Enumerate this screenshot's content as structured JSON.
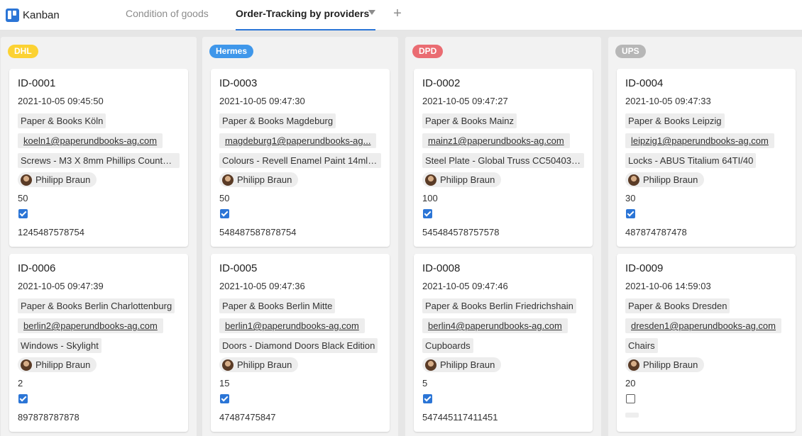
{
  "app": {
    "title": "Kanban",
    "icon": "kanban-board-icon"
  },
  "tabs": {
    "inactive_label": "Condition of goods",
    "active_label": "Order-Tracking by providers",
    "add_label": "+"
  },
  "colors": {
    "accent": "#2b75d6",
    "dhl": "#fcd232",
    "hermes": "#3f97ea",
    "dpd": "#ea6c72",
    "ups": "#b7b7b7"
  },
  "columns": [
    {
      "label": "DHL",
      "cards": [
        {
          "id": "ID-0001",
          "date": "2021-10-05 09:45:50",
          "store": "Paper & Books Köln",
          "email": "koeln1@paperundbooks-ag.com",
          "product": "Screws - M3 X 8mm Phillips Counter…",
          "user": "Philipp Braun",
          "qty": "50",
          "checked": true,
          "tracking": "1245487578754"
        },
        {
          "id": "ID-0006",
          "date": "2021-10-05 09:47:39",
          "store": "Paper & Books Berlin Charlottenburg",
          "email": "berlin2@paperundbooks-ag.com",
          "product": "Windows - Skylight",
          "user": "Philipp Braun",
          "qty": "2",
          "checked": true,
          "tracking": "897878787878"
        }
      ]
    },
    {
      "label": "Hermes",
      "cards": [
        {
          "id": "ID-0003",
          "date": "2021-10-05 09:47:30",
          "store": "Paper & Books Magdeburg",
          "email": "magdeburg1@paperundbooks-ag...",
          "product": "Colours - Revell Enamel Paint 14ml -...",
          "user": "Philipp Braun",
          "qty": "50",
          "checked": true,
          "tracking": "548487587878754"
        },
        {
          "id": "ID-0005",
          "date": "2021-10-05 09:47:36",
          "store": "Paper & Books Berlin Mitte",
          "email": "berlin1@paperundbooks-ag.com",
          "product": "Doors - Diamond Doors Black Edition",
          "user": "Philipp Braun",
          "qty": "15",
          "checked": true,
          "tracking": "47487475847"
        }
      ]
    },
    {
      "label": "DPD",
      "cards": [
        {
          "id": "ID-0002",
          "date": "2021-10-05 09:47:27",
          "store": "Paper & Books Mainz",
          "email": "mainz1@paperundbooks-ag.com",
          "product": "Steel Plate - Global Truss CC50403 B...",
          "user": "Philipp Braun",
          "qty": "100",
          "checked": true,
          "tracking": "545484578757578"
        },
        {
          "id": "ID-0008",
          "date": "2021-10-05 09:47:46",
          "store": "Paper & Books Berlin Friedrichshain",
          "email": "berlin4@paperundbooks-ag.com",
          "product": "Cupboards",
          "user": "Philipp Braun",
          "qty": "5",
          "checked": true,
          "tracking": "547445117411451"
        }
      ]
    },
    {
      "label": "UPS",
      "cards": [
        {
          "id": "ID-0004",
          "date": "2021-10-05 09:47:33",
          "store": "Paper & Books Leipzig",
          "email": "leipzig1@paperundbooks-ag.com",
          "product": "Locks - ABUS Titalium 64TI/40",
          "user": "Philipp Braun",
          "qty": "30",
          "checked": true,
          "tracking": "487874787478"
        },
        {
          "id": "ID-0009",
          "date": "2021-10-06 14:59:03",
          "store": "Paper & Books Dresden",
          "email": "dresden1@paperundbooks-ag.com",
          "product": "Chairs",
          "user": "Philipp Braun",
          "qty": "20",
          "checked": false,
          "tracking": ""
        }
      ]
    }
  ]
}
